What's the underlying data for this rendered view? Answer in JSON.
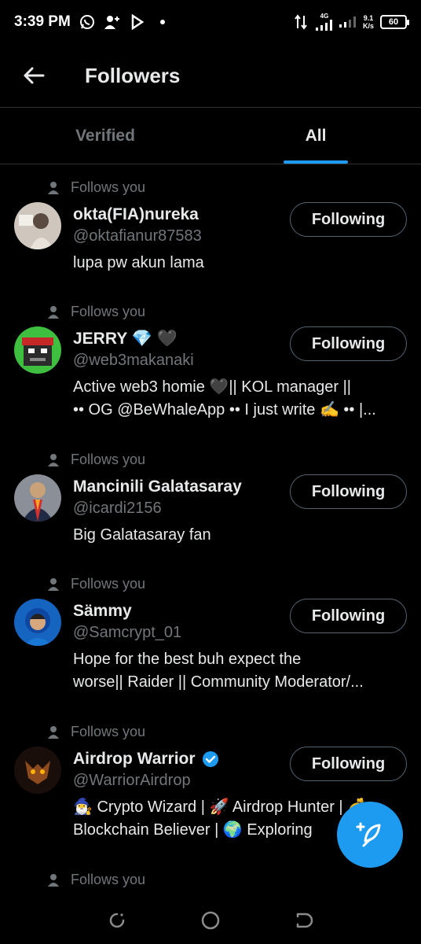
{
  "status_bar": {
    "time": "3:39 PM",
    "network": "4G",
    "speed_value": "9.1",
    "speed_unit": "K/s",
    "battery": "60",
    "icons": [
      "whatsapp-icon",
      "person-add-icon",
      "bilibili-icon",
      "dot-icon",
      "data-transfer-icon",
      "signal-icon",
      "signal-icon-2",
      "battery-icon"
    ]
  },
  "header": {
    "title": "Followers",
    "back_icon": "arrow-left-icon"
  },
  "tabs": [
    {
      "label": "Verified",
      "active": false
    },
    {
      "label": "All",
      "active": true
    }
  ],
  "follows_you_label": "Follows you",
  "button_label": "Following",
  "followers": [
    {
      "name": "okta(FIA)nureka",
      "handle": "@oktafianur87583",
      "bio": [
        "lupa pw akun lama"
      ],
      "badges": []
    },
    {
      "name": "JERRY 💎 🖤",
      "handle": "@web3makanaki",
      "bio": [
        "Active web3 homie 🖤|| KOL manager ||",
        "•• OG @BeWhaleApp •• I just write ✍️ •• |..."
      ],
      "badges": []
    },
    {
      "name": "Mancinili Galatasaray",
      "handle": "@icardi2156",
      "bio": [
        "Big Galatasaray fan"
      ],
      "badges": []
    },
    {
      "name": "Sämmy",
      "handle": "@Samcrypt_01",
      "bio": [
        "Hope for the best buh expect the",
        "worse|| Raider || Community Moderator/..."
      ],
      "badges": []
    },
    {
      "name": "Airdrop Warrior",
      "handle": "@WarriorAirdrop",
      "bio": [
        "🧙‍♂️ Crypto Wizard | 🚀 Airdrop Hunter | 💰",
        "Blockchain Believer | 🌍 Exploring"
      ],
      "badges": [
        "verified-badge-icon"
      ]
    }
  ],
  "fab_icon": "compose-post-icon",
  "nav": [
    "recents-icon",
    "home-icon",
    "back-icon"
  ],
  "colors": {
    "accent": "#1d9bf0",
    "background": "#000000",
    "secondary_text": "#71767b",
    "primary_text": "#e7e9ea"
  }
}
